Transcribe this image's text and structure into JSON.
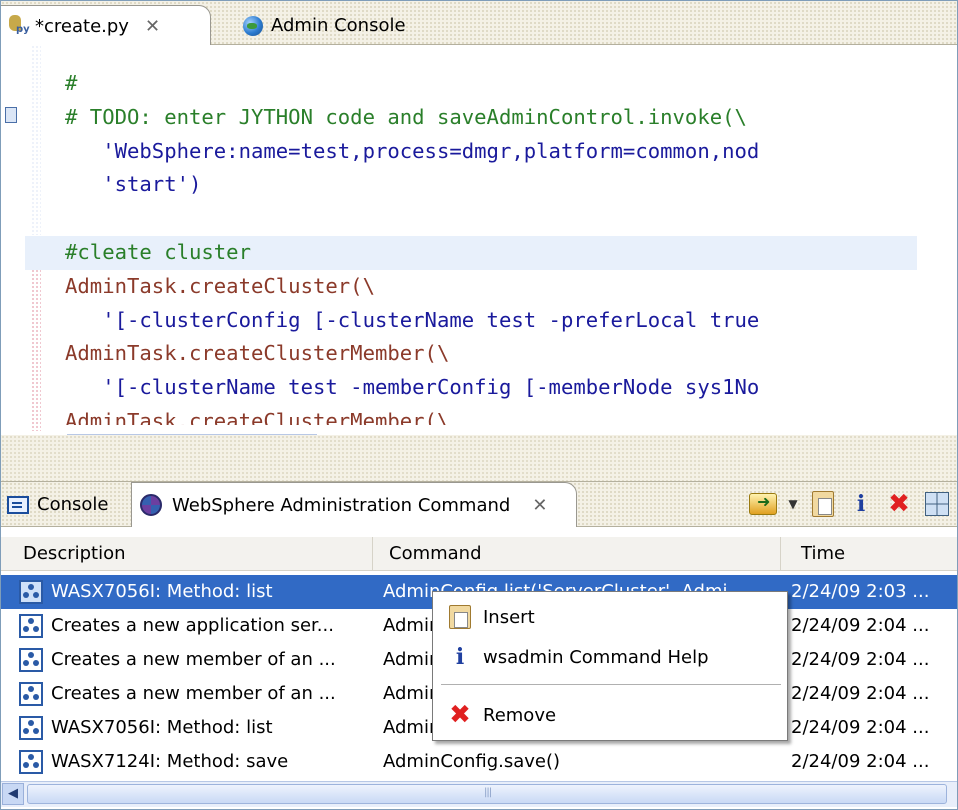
{
  "editor": {
    "tabs": [
      {
        "label": "*create.py",
        "active": true,
        "icon": "python-file-icon",
        "close": "✕"
      },
      {
        "label": "Admin Console",
        "active": false,
        "icon": "globe-icon"
      }
    ],
    "code_lines": [
      "#",
      "# TODO: enter JYTHON code and saveAdminControl.invoke(\\",
      "   'WebSphere:name=test,process=dmgr,platform=common,nod",
      "   'start')",
      "",
      "#cleate cluster",
      "AdminTask.createCluster(\\",
      "   '[-clusterConfig [-clusterName test -preferLocal true",
      "AdminTask.createClusterMember(\\",
      "   '[-clusterName test -memberConfig [-memberNode sys1No",
      "AdminTask.createClusterMember(\\"
    ]
  },
  "views": {
    "tabs": [
      {
        "label": "Console",
        "icon": "console-icon"
      },
      {
        "label": "WebSphere Administration Command",
        "icon": "websphere-icon",
        "close": "✕",
        "active": true
      }
    ],
    "toolbar": [
      "run-icon",
      "dropdown-icon",
      "paste-icon",
      "info-icon",
      "remove-icon",
      "table-icon"
    ]
  },
  "table": {
    "columns": [
      "Description",
      "Command",
      "Time"
    ],
    "rows": [
      {
        "description": "WASX7056I: Method: list",
        "command": "AdminConfig.list('ServerCluster', Admi",
        "time": "2/24/09 2:03 ...",
        "selected": true
      },
      {
        "description": "Creates a new application ser...",
        "command": "Admin",
        "time": "2/24/09 2:04 ..."
      },
      {
        "description": "Creates a new member of an ...",
        "command": "Admin",
        "time": "2/24/09 2:04 ..."
      },
      {
        "description": "Creates a new member of an ...",
        "command": "Admin",
        "time": "2/24/09 2:04 ..."
      },
      {
        "description": "WASX7056I: Method: list",
        "command": "Admin",
        "time": "2/24/09 2:04 ..."
      },
      {
        "description": "WASX7124I: Method: save",
        "command": "AdminConfig.save()",
        "time": "2/24/09 2:04 ..."
      }
    ]
  },
  "context_menu": {
    "items": [
      {
        "label": "Insert",
        "icon": "paste-icon"
      },
      {
        "label": "wsadmin Command Help",
        "icon": "info-icon"
      },
      {
        "label": "Remove",
        "icon": "remove-icon"
      }
    ]
  },
  "colors": {
    "selection": "#316ac5",
    "comment": "#2a7f2a",
    "keyword": "#8b3a2a",
    "string": "#1a1a9c"
  }
}
